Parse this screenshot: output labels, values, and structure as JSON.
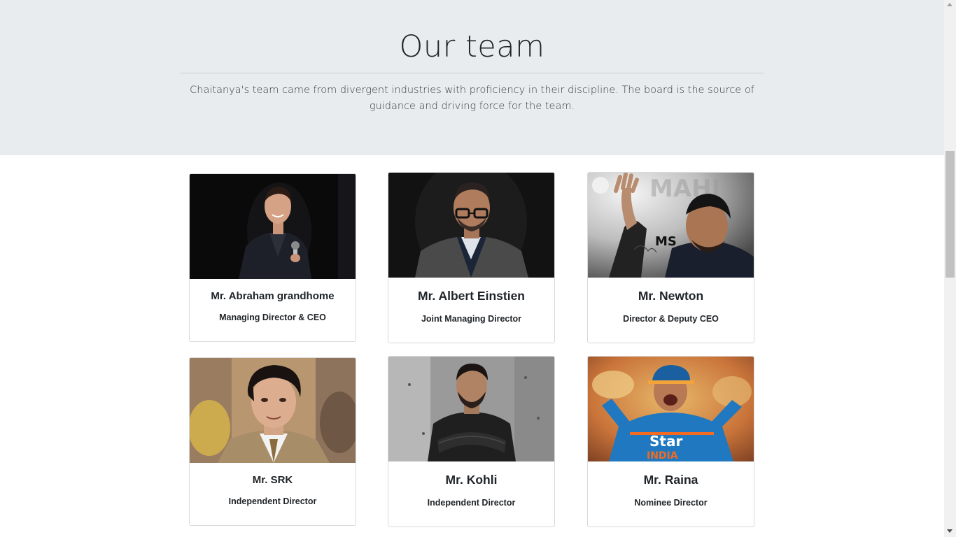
{
  "hero": {
    "title": "Our team",
    "lead": "Chaitanya's team came from divergent industries with proficiency in their discipline. The board is the source of guidance and driving force for the team."
  },
  "team": [
    {
      "name": "Mr. Abraham grandhome",
      "role": "Managing Director & CEO"
    },
    {
      "name": "Mr. Albert Einstien",
      "role": "Joint Managing Director"
    },
    {
      "name": "Mr. Newton",
      "role": "Director & Deputy CEO"
    },
    {
      "name": "Mr. SRK",
      "role": "Independent Director"
    },
    {
      "name": "Mr. Kohli",
      "role": "Independent Director"
    },
    {
      "name": "Mr. Raina",
      "role": "Nominee Director"
    }
  ],
  "photo_overlays": {
    "newton_logo": "MS",
    "newton_watermark": "MAHI",
    "raina_jersey": "Star",
    "raina_jersey_country": "INDIA"
  }
}
